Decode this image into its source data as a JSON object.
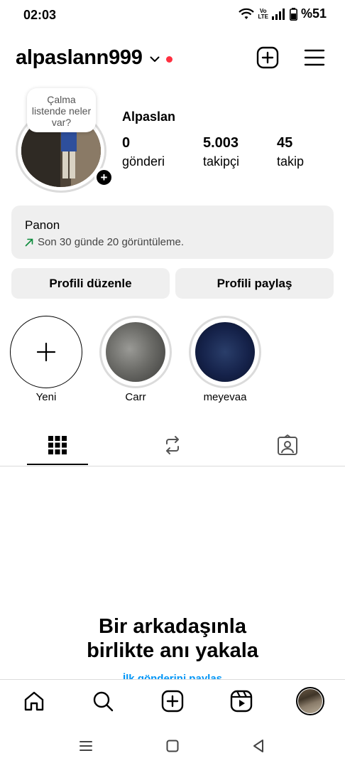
{
  "status_bar": {
    "time": "02:03",
    "volte_top": "Vo",
    "volte_bottom": "LTE",
    "battery": "%51"
  },
  "header": {
    "username": "alpaslann999",
    "icons": [
      "chevron-down-icon",
      "notification-dot",
      "new-post-icon",
      "menu-icon"
    ],
    "accent": "#ff3040"
  },
  "profile": {
    "note_text": "Çalma listende neler var?",
    "display_name": "Alpaslan",
    "stats": [
      {
        "value": "0",
        "label": "gönderi"
      },
      {
        "value": "5.003",
        "label": "takipçi"
      },
      {
        "value": "45",
        "label": "takip"
      }
    ]
  },
  "dashboard": {
    "title": "Panon",
    "subtitle": "Son 30 günde 20 görüntüleme.",
    "arrow_color": "#0a8a3a"
  },
  "buttons": {
    "edit_profile": "Profili düzenle",
    "share_profile": "Profili paylaş"
  },
  "highlights": [
    {
      "label": "Yeni"
    },
    {
      "label": "Carr"
    },
    {
      "label": "meyevaa"
    }
  ],
  "tabs": [
    {
      "name": "grid-icon",
      "active": true
    },
    {
      "name": "repost-icon",
      "active": false
    },
    {
      "name": "tagged-icon",
      "active": false
    }
  ],
  "empty_state": {
    "title_line1": "Bir arkadaşınla",
    "title_line2": "birlikte anı yakala",
    "link_text": "İlk gönderini paylaş"
  },
  "bottom_nav": [
    "home-icon",
    "search-icon",
    "create-icon",
    "reels-icon",
    "profile-avatar"
  ],
  "system_nav": [
    "recents-icon",
    "home-square-icon",
    "back-icon"
  ]
}
